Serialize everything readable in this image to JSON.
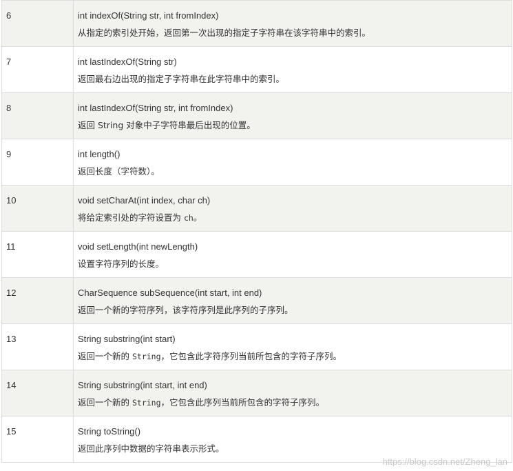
{
  "rows": [
    {
      "num": "6",
      "signature": "int indexOf(String str, int fromIndex)",
      "desc_before": "从指定的索引处开始，返回第一次出现的指定子字符串在该字符串中的索引。",
      "desc_code": "",
      "desc_after": ""
    },
    {
      "num": "7",
      "signature": "int lastIndexOf(String str)",
      "desc_before": "返回最右边出现的指定子字符串在此字符串中的索引。",
      "desc_code": "",
      "desc_after": ""
    },
    {
      "num": "8",
      "signature": "int lastIndexOf(String str, int fromIndex)",
      "desc_before": "返回 String 对象中子字符串最后出现的位置。",
      "desc_code": "",
      "desc_after": ""
    },
    {
      "num": "9",
      "signature": "int length()",
      "desc_before": " 返回长度（字符数）。",
      "desc_code": "",
      "desc_after": ""
    },
    {
      "num": "10",
      "signature": "void setCharAt(int index, char ch)",
      "desc_before": "将给定索引处的字符设置为 ",
      "desc_code": "ch",
      "desc_after": "。"
    },
    {
      "num": "11",
      "signature": "void setLength(int newLength)",
      "desc_before": "设置字符序列的长度。",
      "desc_code": "",
      "desc_after": ""
    },
    {
      "num": "12",
      "signature": "CharSequence subSequence(int start, int end)",
      "desc_before": "返回一个新的字符序列，该字符序列是此序列的子序列。",
      "desc_code": "",
      "desc_after": ""
    },
    {
      "num": "13",
      "signature": "String substring(int start)",
      "desc_before": "返回一个新的 ",
      "desc_code": "String",
      "desc_after": "，它包含此字符序列当前所包含的字符子序列。"
    },
    {
      "num": "14",
      "signature": "String substring(int start, int end)",
      "desc_before": "返回一个新的 ",
      "desc_code": "String",
      "desc_after": "，它包含此序列当前所包含的字符子序列。"
    },
    {
      "num": "15",
      "signature": "String toString()",
      "desc_before": "返回此序列中数据的字符串表示形式。",
      "desc_code": "",
      "desc_after": ""
    }
  ],
  "watermark": "https://blog.csdn.net/Zheng_lan"
}
